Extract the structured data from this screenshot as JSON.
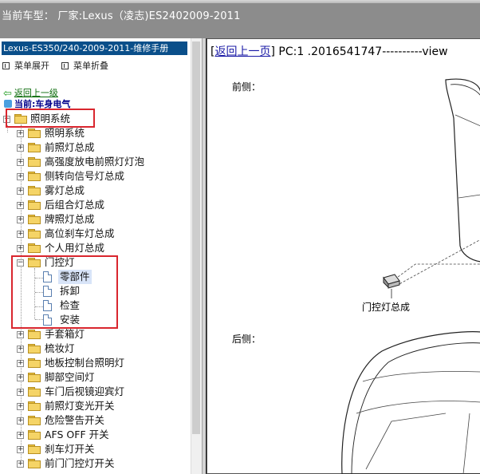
{
  "header": {
    "title": "当前车型： 厂家:Lexus（凌志)ES2402009-2011"
  },
  "left_panel": {
    "manual_title": "Lexus-ES350/240-2009-2011-维修手册",
    "toolbar": {
      "expand_label": "菜单展开",
      "collapse_label": "菜单折叠"
    },
    "back_link": "返回上一级",
    "current": "当前:车身电气",
    "tree": {
      "root": "照明系统",
      "items": [
        "照明系统",
        "前照灯总成",
        "高强度放电前照灯灯泡",
        "侧转向信号灯总成",
        "雾灯总成",
        "后组合灯总成",
        "牌照灯总成",
        "高位刹车灯总成",
        "个人用灯总成"
      ],
      "open_folder": "门控灯",
      "open_children": [
        "零部件",
        "拆卸",
        "检查",
        "安装"
      ],
      "items_after": [
        "手套箱灯",
        "梳妆灯",
        "地板控制台照明灯",
        "脚部空间灯",
        "车门后视镜迎宾灯",
        "前照灯变光开关",
        "危险警告开关",
        "AFS OFF 开关",
        "刹车灯开关",
        "前门门控灯开关"
      ]
    }
  },
  "right_panel": {
    "back_link": "返回上一页",
    "doc_path": "PC:1 .2016541747----------view",
    "front_label": "前侧：",
    "rear_label": "后侧：",
    "callout": "门控灯总成"
  },
  "colors": {
    "header_bg": "#8c8c8c",
    "title_bg": "#0a4f8a",
    "highlight_box": "#d9262e"
  }
}
